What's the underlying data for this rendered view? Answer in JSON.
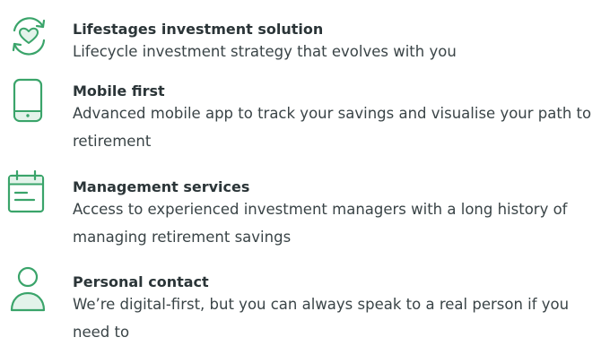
{
  "features": [
    {
      "icon": "recycle-heart-icon",
      "title": "Lifestages investment solution",
      "description": "Lifecycle investment strategy that evolves with you"
    },
    {
      "icon": "mobile-phone-icon",
      "title": "Mobile first",
      "description": "Advanced mobile app to track your savings and visualise your path to retirement"
    },
    {
      "icon": "calendar-icon",
      "title": "Management services",
      "description": "Access to experienced investment managers with a long history of managing retirement savings"
    },
    {
      "icon": "person-icon",
      "title": "Personal contact",
      "description": "We’re digital-first, but you can always speak to a real person if you need to"
    }
  ],
  "colors": {
    "icon_accent": "#3aa46a",
    "icon_fill_light": "#e3f3ea",
    "text": "#2f3a3d"
  }
}
